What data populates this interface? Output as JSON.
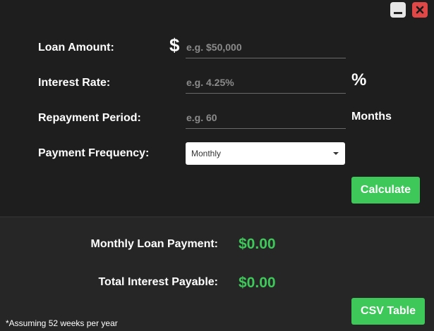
{
  "window": {
    "minimize_icon": "minimize-icon",
    "close_icon": "close-icon"
  },
  "form": {
    "loan_amount": {
      "label": "Loan Amount:",
      "currency_symbol": "$",
      "value": "",
      "placeholder": "e.g. $50,000"
    },
    "interest_rate": {
      "label": "Interest Rate:",
      "value": "",
      "placeholder": "e.g. 4.25%",
      "suffix": "%"
    },
    "repayment_period": {
      "label": "Repayment Period:",
      "value": "",
      "placeholder": "e.g. 60",
      "suffix": "Months"
    },
    "payment_frequency": {
      "label": "Payment Frequency:",
      "selected": "Monthly"
    },
    "calculate_label": "Calculate"
  },
  "results": {
    "monthly_payment_label": "Monthly Loan Payment:",
    "monthly_payment_value": "$0.00",
    "total_interest_label": "Total Interest Payable:",
    "total_interest_value": "$0.00",
    "csv_label": "CSV Table",
    "footnote": "*Assuming 52 weeks per year"
  },
  "colors": {
    "accent": "#3ec85a",
    "close": "#e04747",
    "background": "#1e1e1e"
  }
}
